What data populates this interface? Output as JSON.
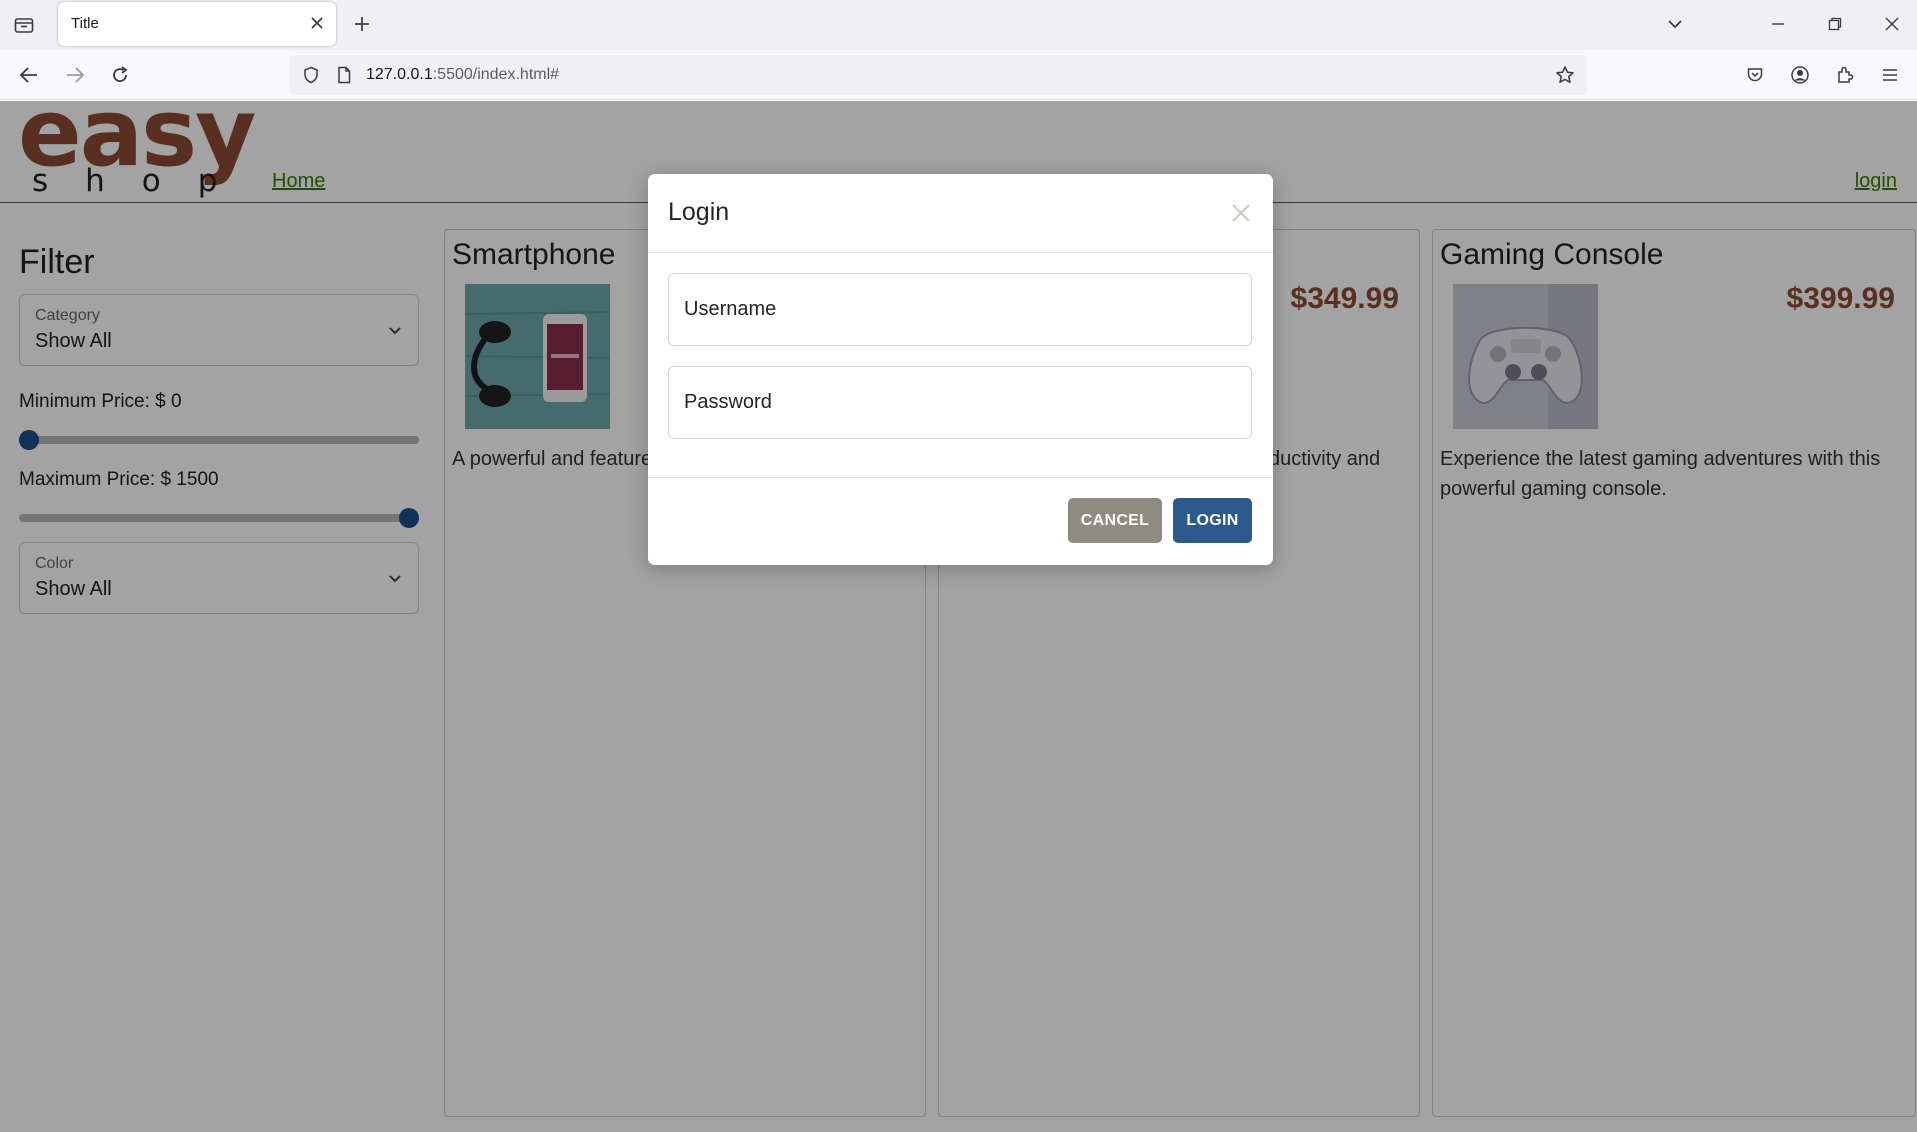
{
  "browser": {
    "tab_title": "Title",
    "url_host": "127.0.0.1",
    "url_rest": ":5500/index.html#",
    "icons": [
      "tab-list-icon",
      "close-icon",
      "new-tab-icon",
      "tab-overflow-chevron-icon",
      "minimize-icon",
      "restore-icon",
      "window-close-icon",
      "back-icon",
      "forward-icon",
      "reload-icon",
      "shield-icon",
      "page-icon",
      "star-icon",
      "pocket-icon",
      "account-icon",
      "extensions-icon",
      "menu-icon"
    ]
  },
  "header": {
    "logo_top": "easy",
    "logo_bottom": "shop",
    "nav_home": "Home",
    "nav_login": "login"
  },
  "filter": {
    "title": "Filter",
    "category": {
      "label": "Category",
      "value": "Show All"
    },
    "min_price": {
      "label": "Minimum Price: $ 0",
      "fraction": 0.0
    },
    "max_price": {
      "label": "Maximum Price: $ 1500",
      "fraction": 1.0
    },
    "color": {
      "label": "Color",
      "value": "Show All"
    }
  },
  "products": [
    {
      "title": "Smartphone",
      "price": "",
      "description": "A powerful and feature communication needs",
      "image": "headphones-and-phone"
    },
    {
      "title": "",
      "price": "$349.99",
      "description": "ductivity and",
      "image": ""
    },
    {
      "title": "Gaming Console",
      "price": "$399.99",
      "description": "Experience the latest gaming adventures with this powerful gaming console.",
      "image": "game-controller"
    }
  ],
  "modal": {
    "title": "Login",
    "username_placeholder": "Username",
    "password_placeholder": "Password",
    "cancel_label": "CANCEL",
    "login_label": "LOGIN"
  },
  "colors": {
    "brand_brown": "#8a4a33",
    "link_green": "#3d7a00",
    "login_button": "#2c5a8c",
    "cancel_button": "#8e8b82"
  }
}
